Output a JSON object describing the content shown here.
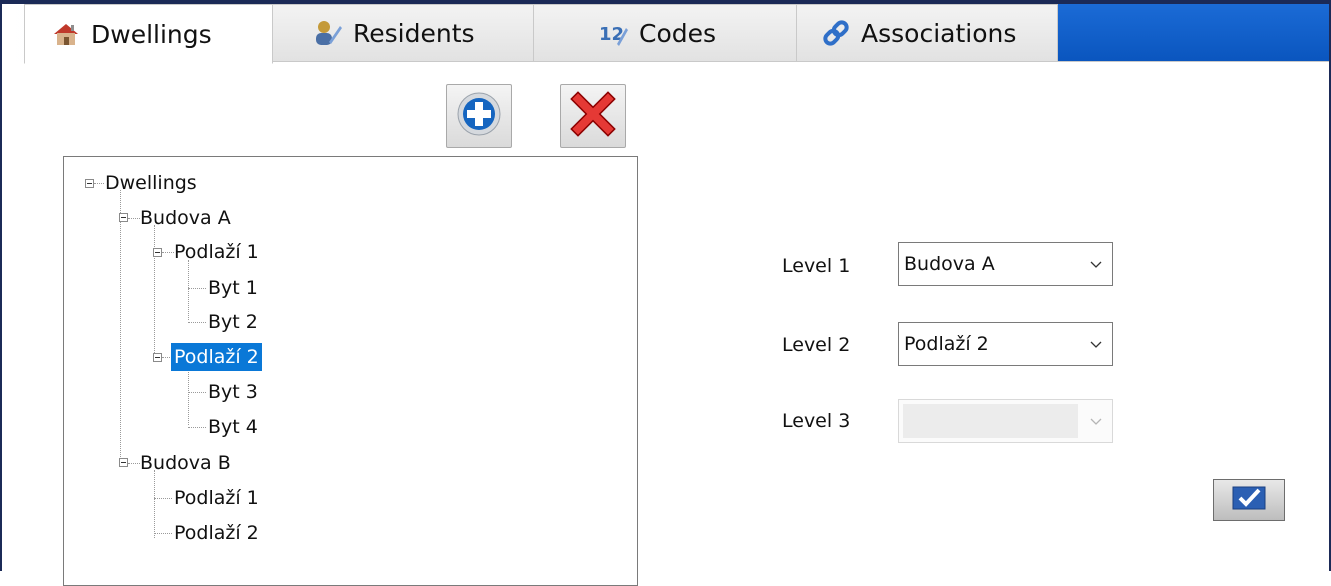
{
  "tabs": [
    {
      "label": "Dwellings",
      "icon": "house-icon",
      "active": true
    },
    {
      "label": "Residents",
      "icon": "residents-icon",
      "active": false
    },
    {
      "label": "Codes",
      "icon": "codes-icon",
      "active": false
    },
    {
      "label": "Associations",
      "icon": "link-icon",
      "active": false
    }
  ],
  "toolbar": {
    "add_icon": "plus-icon",
    "delete_icon": "red-x-icon"
  },
  "tree": {
    "root": "Dwellings",
    "buildings": [
      {
        "label": "Budova A",
        "floors": [
          {
            "label": "Podlaží 1",
            "flats": [
              "Byt 1",
              "Byt 2"
            ]
          },
          {
            "label": "Podlaží 2",
            "flats": [
              "Byt 3",
              "Byt 4"
            ],
            "selected": true
          }
        ]
      },
      {
        "label": "Budova B",
        "floors": [
          {
            "label": "Podlaží 1",
            "flats": []
          },
          {
            "label": "Podlaží 2",
            "flats": []
          }
        ]
      }
    ],
    "selection_color": "#0a78d7"
  },
  "form": {
    "level1": {
      "label": "Level 1",
      "value": "Budova A"
    },
    "level2": {
      "label": "Level 2",
      "value": "Podlaží 2"
    },
    "level3": {
      "label": "Level 3",
      "value": "",
      "disabled": true
    }
  },
  "confirm_icon": "checkmark-icon",
  "colors": {
    "accent_blue": "#0a55be",
    "frame": "#1b2a57"
  }
}
